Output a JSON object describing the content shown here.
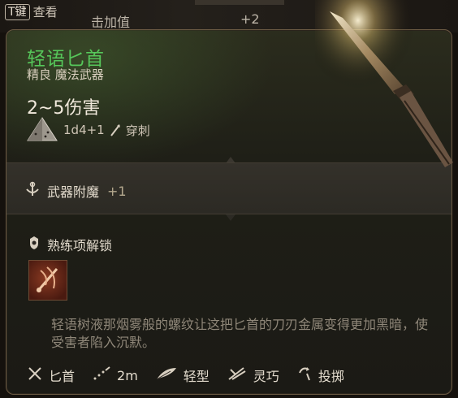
{
  "background": {
    "key_hint": {
      "key": "T键",
      "label": "查看"
    },
    "row_label": "击加值",
    "row_value": "+2"
  },
  "item": {
    "name": "轻语匕首",
    "rarity_type": "精良 魔法武器",
    "damage": "2~5伤害",
    "dice": "1d4+1",
    "damage_type": "穿刺",
    "name_color": "#56c65a"
  },
  "enchant": {
    "label": "武器附魔",
    "bonus": "+1"
  },
  "proficiency": {
    "header": "熟练项解锁"
  },
  "flavor_text": "轻语树液那烟雾般的螺纹让这把匕首的刀刃金属变得更加黑暗，使受害者陷入沉默。",
  "tags": [
    {
      "icon": "crossed-daggers-icon",
      "label": "匕首"
    },
    {
      "icon": "range-icon",
      "label": "2m"
    },
    {
      "icon": "feather-icon",
      "label": "轻型"
    },
    {
      "icon": "finesse-icon",
      "label": "灵巧"
    },
    {
      "icon": "throw-icon",
      "label": "投掷"
    }
  ]
}
